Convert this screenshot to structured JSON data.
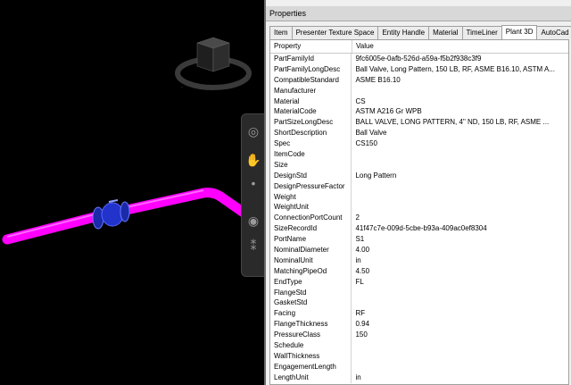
{
  "properties_panel": {
    "title": "Properties",
    "tabs": [
      {
        "label": "Item"
      },
      {
        "label": "Presenter Texture Space"
      },
      {
        "label": "Entity Handle"
      },
      {
        "label": "Material"
      },
      {
        "label": "TimeLiner"
      },
      {
        "label": "Plant 3D",
        "active": true
      },
      {
        "label": "AutoCad"
      }
    ],
    "columns": {
      "property": "Property",
      "value": "Value"
    },
    "rows": [
      {
        "property": "PartFamilyId",
        "value": "9fc6005e-0afb-526d-a59a-f5b2f938c3f9"
      },
      {
        "property": "PartFamilyLongDesc",
        "value": "Ball Valve, Long Pattern, 150 LB, RF, ASME B16.10, ASTM A..."
      },
      {
        "property": "CompatibleStandard",
        "value": "ASME B16.10"
      },
      {
        "property": "Manufacturer",
        "value": ""
      },
      {
        "property": "Material",
        "value": "CS"
      },
      {
        "property": "MaterialCode",
        "value": "ASTM A216 Gr WPB"
      },
      {
        "property": "PartSizeLongDesc",
        "value": "BALL VALVE, LONG PATTERN, 4\" ND, 150 LB, RF, ASME ..."
      },
      {
        "property": "ShortDescription",
        "value": "Ball Valve"
      },
      {
        "property": "Spec",
        "value": "CS150"
      },
      {
        "property": "ItemCode",
        "value": ""
      },
      {
        "property": "Size",
        "value": ""
      },
      {
        "property": "DesignStd",
        "value": "Long Pattern"
      },
      {
        "property": "DesignPressureFactor",
        "value": ""
      },
      {
        "property": "Weight",
        "value": ""
      },
      {
        "property": "WeightUnit",
        "value": ""
      },
      {
        "property": "ConnectionPortCount",
        "value": "2"
      },
      {
        "property": "SizeRecordId",
        "value": "41f47c7e-009d-5cbe-b93a-409ac0ef8304"
      },
      {
        "property": "PortName",
        "value": "S1"
      },
      {
        "property": "NominalDiameter",
        "value": "4.00"
      },
      {
        "property": "NominalUnit",
        "value": "in"
      },
      {
        "property": "MatchingPipeOd",
        "value": "4.50"
      },
      {
        "property": "EndType",
        "value": "FL"
      },
      {
        "property": "FlangeStd",
        "value": ""
      },
      {
        "property": "GasketStd",
        "value": ""
      },
      {
        "property": "Facing",
        "value": "RF"
      },
      {
        "property": "FlangeThickness",
        "value": "0.94"
      },
      {
        "property": "PressureClass",
        "value": "150"
      },
      {
        "property": "Schedule",
        "value": ""
      },
      {
        "property": "WallThickness",
        "value": ""
      },
      {
        "property": "EngagementLength",
        "value": ""
      },
      {
        "property": "LengthUnit",
        "value": "in"
      }
    ]
  },
  "viewport": {
    "pipe_color": "#ff00ff",
    "valve_color": "#2233cc",
    "background_color": "#000000"
  },
  "nav_bar": {
    "icons": [
      "steering-wheel-icon",
      "pan-hand-icon",
      "zoom-icon",
      "orbit-icon",
      "walk-icon"
    ]
  }
}
